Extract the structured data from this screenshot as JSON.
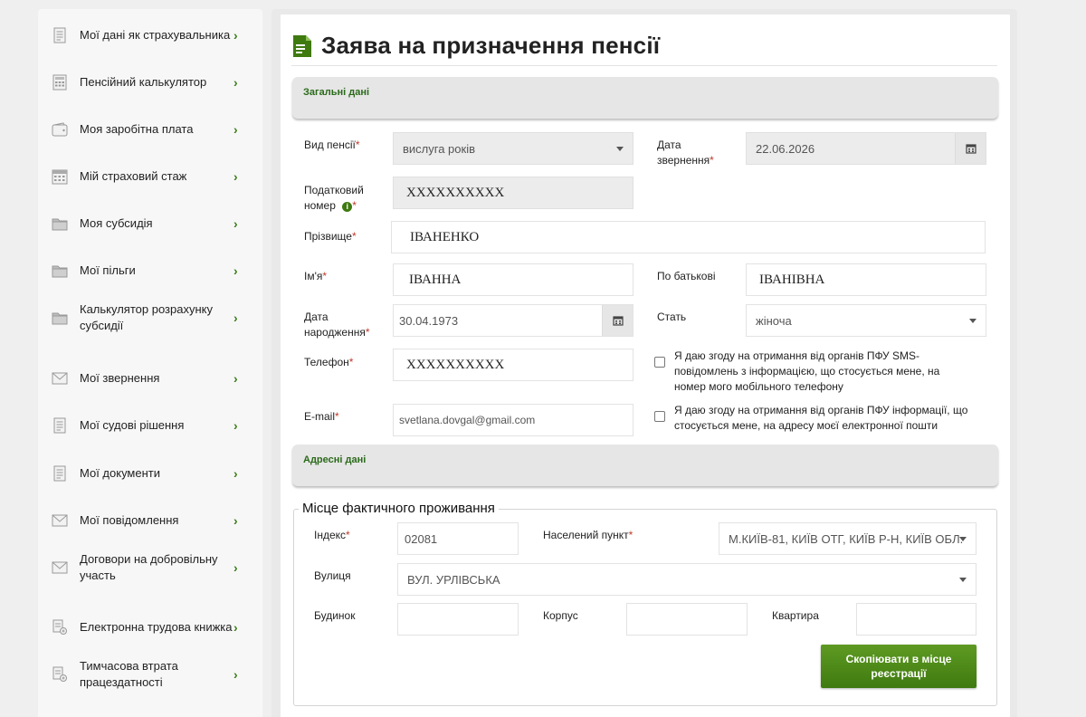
{
  "sidebar": {
    "items": [
      {
        "label": "Мої дані як страхувальника",
        "icon": "document-icon"
      },
      {
        "label": "Пенсійний калькулятор",
        "icon": "calculator-icon"
      },
      {
        "label": "Моя заробітна плата",
        "icon": "wallet-icon"
      },
      {
        "label": "Мій страховий стаж",
        "icon": "calendar-icon"
      },
      {
        "label": "Моя субсидія",
        "icon": "folder-icon"
      },
      {
        "label": "Мої пільги",
        "icon": "folder-icon"
      },
      {
        "label": "Калькулятор розрахунку субсидії",
        "icon": "folder-icon"
      },
      {
        "label": "Мої звернення",
        "icon": "envelope-icon"
      },
      {
        "label": "Мої судові рішення",
        "icon": "document-icon"
      },
      {
        "label": "Мої документи",
        "icon": "document-icon"
      },
      {
        "label": "Мої повідомлення",
        "icon": "envelope-icon"
      },
      {
        "label": "Договори на добровільну участь",
        "icon": "envelope-icon"
      },
      {
        "label": "Електронна трудова книжка",
        "icon": "workbook-icon"
      },
      {
        "label": "Тимчасова втрата працездатності",
        "icon": "workbook-icon"
      }
    ]
  },
  "page": {
    "title": "Заява на призначення пенсії"
  },
  "general": {
    "section_title": "Загальні дані",
    "pension_type": {
      "label": "Вид пенсії",
      "value": "вислуга років"
    },
    "application_date": {
      "label_line1": "Дата",
      "label_line2": "звернення",
      "value": "22.06.2026"
    },
    "tax_number": {
      "label_line1": "Податковий",
      "label_line2": "номер",
      "value": "XXXXXXXXXX"
    },
    "surname": {
      "label": "Прізвище",
      "value": "ІВАНЕНКО"
    },
    "name": {
      "label": "Ім'я",
      "value": "ІВАННА"
    },
    "patronymic": {
      "label": "По батькові",
      "value": "ІВАНІВНА"
    },
    "birth_date": {
      "label_line1": "Дата",
      "label_line2": "народження",
      "value": "30.04.1973"
    },
    "sex": {
      "label": "Стать",
      "value": "жіноча"
    },
    "phone": {
      "label": "Телефон",
      "value": "XXXXXXXXXX"
    },
    "email": {
      "label": "E-mail",
      "value": "svetlana.dovgal@gmail.com"
    },
    "sms_consent": "Я даю згоду на отримання від органів ПФУ SMS-повідомлень з інформацією, що стосується мене, на номер мого мобільного телефону",
    "email_consent": "Я даю згоду на отримання від органів ПФУ інформації, що стосується мене, на адресу моєї електронної пошти"
  },
  "address": {
    "section_title": "Адресні дані",
    "legend": "Місце фактичного проживання",
    "index": {
      "label": "Індекс",
      "value": "02081"
    },
    "locality": {
      "label": "Населений пункт",
      "value": "М.КИЇВ-81, КИЇВ ОТГ, КИЇВ Р-Н, КИЇВ ОБЛ."
    },
    "street": {
      "label": "Вулиця",
      "value": "ВУЛ. УРЛІВСЬКА"
    },
    "house": {
      "label": "Будинок",
      "value": ""
    },
    "building": {
      "label": "Корпус",
      "value": ""
    },
    "apartment": {
      "label": "Квартира",
      "value": ""
    },
    "copy_button": "Скопіювати в місце реєстрації"
  },
  "colors": {
    "accent": "#3f7a10",
    "required": "#c0392b",
    "section_text": "#2a6a1a"
  }
}
